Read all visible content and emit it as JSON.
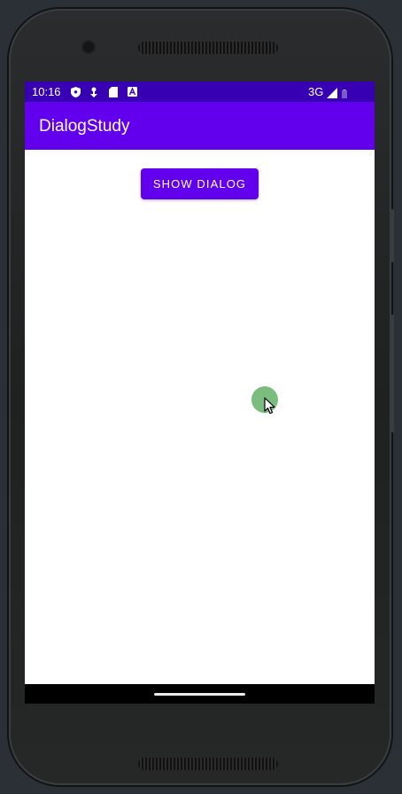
{
  "status_bar": {
    "time": "10:16",
    "icons": [
      "shield-icon",
      "location-icon",
      "sd-card-icon",
      "a-notification-icon"
    ],
    "network": "3G",
    "signal_icon": "signal-icon",
    "battery_icon": "battery-icon"
  },
  "app_bar": {
    "title": "DialogStudy"
  },
  "main": {
    "show_dialog_label": "SHOW DIALOG"
  },
  "colors": {
    "status_bar": "#3700b3",
    "primary": "#6200ee",
    "touch_indicator": "#4fa554",
    "nav_bar": "#000000"
  }
}
